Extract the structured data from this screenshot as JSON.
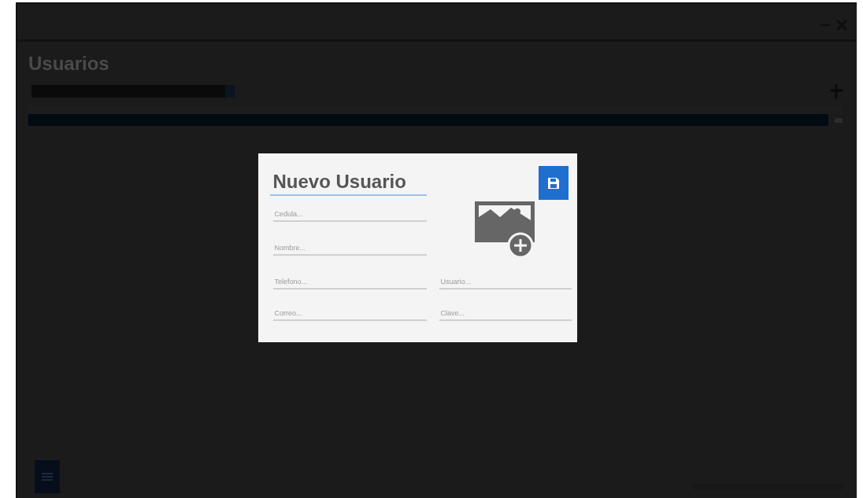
{
  "page": {
    "title": "Usuarios"
  },
  "dialog": {
    "title": "Nuevo Usuario",
    "fields": [
      {
        "placeholder": "Cedula..."
      },
      {
        "placeholder": "Nombre..."
      },
      {
        "placeholder": "Telefono..."
      },
      {
        "placeholder": "Usuario..."
      },
      {
        "placeholder": "Correo..."
      },
      {
        "placeholder": "Clave..."
      }
    ]
  }
}
